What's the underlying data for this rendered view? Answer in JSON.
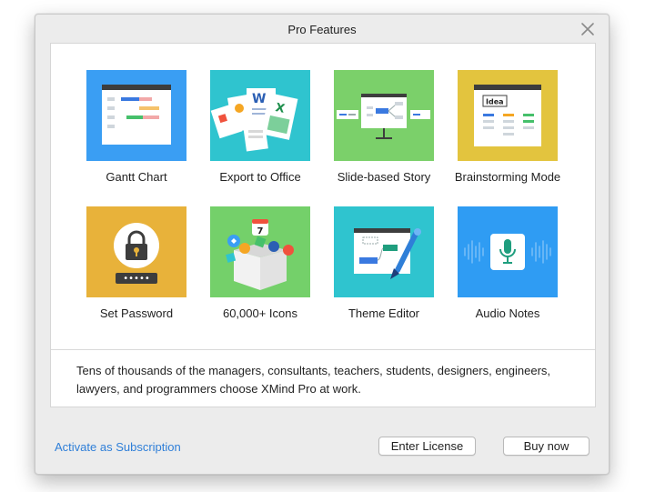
{
  "dialog": {
    "title": "Pro Features",
    "close_icon": "close-icon"
  },
  "features": [
    {
      "label": "Gantt Chart",
      "icon": "gantt-chart-icon",
      "color": "#3a9ef3"
    },
    {
      "label": "Export to Office",
      "icon": "export-office-icon",
      "color": "#2fc4cf"
    },
    {
      "label": "Slide-based Story",
      "icon": "slide-story-icon",
      "color": "#7bd06a"
    },
    {
      "label": "Brainstorming Mode",
      "icon": "brainstorming-icon",
      "color": "#e3c43e"
    },
    {
      "label": "Set Password",
      "icon": "lock-icon",
      "color": "#e8b23a"
    },
    {
      "label": "60,000+ Icons",
      "icon": "icon-box-icon",
      "color": "#74d06a"
    },
    {
      "label": "Theme Editor",
      "icon": "theme-brush-icon",
      "color": "#2fc4cf"
    },
    {
      "label": "Audio Notes",
      "icon": "microphone-icon",
      "color": "#2f9cf3"
    }
  ],
  "brainstorm_tile_text": "Idea",
  "password_mask": "•••••",
  "icons_tile_date": "7",
  "description": "Tens of thousands of the managers, consultants, teachers, students, designers, engineers, lawyers, and programmers choose XMind Pro at work.",
  "footer": {
    "activate_link": "Activate as Subscription",
    "enter_license": "Enter License",
    "buy_now": "Buy now"
  },
  "colors": {
    "link": "#2f7fd8"
  }
}
